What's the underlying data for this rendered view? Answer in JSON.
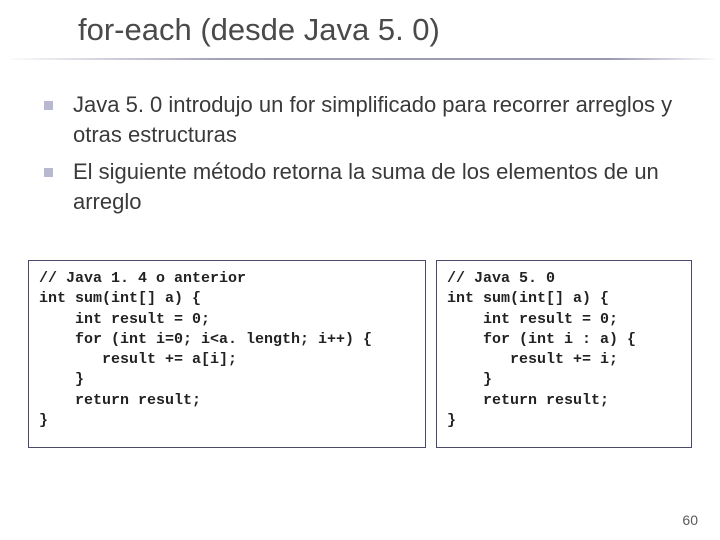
{
  "title": "for-each (desde Java 5. 0)",
  "bullets": [
    "Java 5. 0 introdujo un for simplificado para recorrer arreglos y otras estructuras",
    "El siguiente método retorna la suma de los elementos de un arreglo"
  ],
  "code": {
    "left": "// Java 1. 4 o anterior\nint sum(int[] a) {\n    int result = 0;\n    for (int i=0; i<a. length; i++) {\n       result += a[i];\n    }\n    return result;\n}",
    "right": "// Java 5. 0\nint sum(int[] a) {\n    int result = 0;\n    for (int i : a) {\n       result += i;\n    }\n    return result;\n}"
  },
  "page_number": "60"
}
